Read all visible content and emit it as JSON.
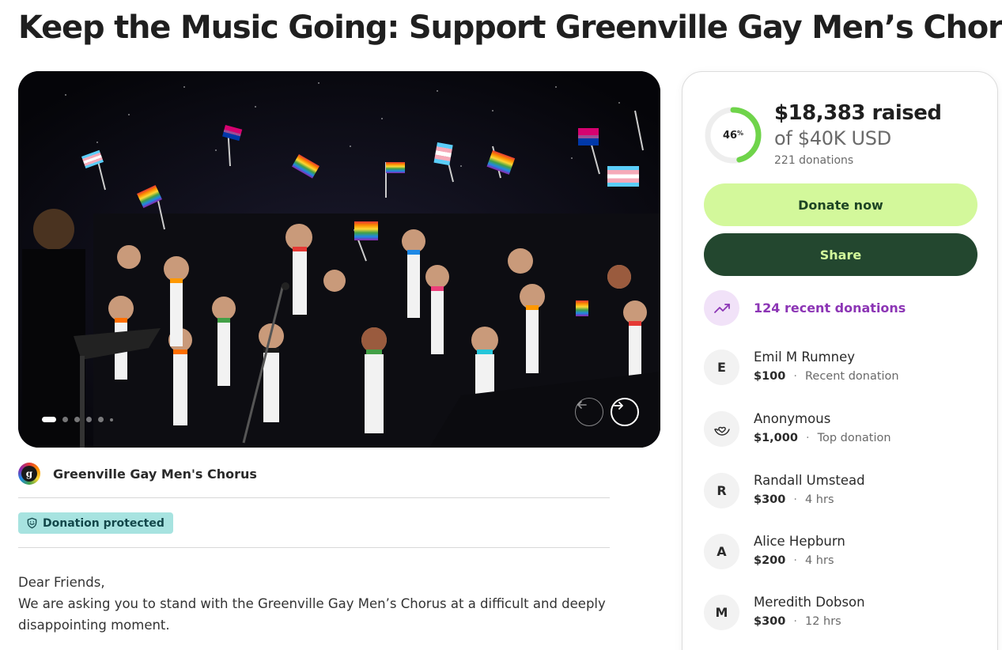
{
  "page": {
    "title": "Keep the Music Going: Support Greenville Gay Men’s Chorus"
  },
  "gallery": {
    "image_icon": "chorus-performance-photo",
    "slide_count": 6,
    "active_slide": 1,
    "prev_icon": "arrow-left-icon",
    "next_icon": "arrow-right-icon"
  },
  "organizer": {
    "logo_letter": "g",
    "name": "Greenville Gay Men's Chorus"
  },
  "badge": {
    "icon": "shield-icon",
    "label": "Donation protected"
  },
  "story": {
    "line1": "Dear Friends,",
    "line2": "We are asking you to stand with the Greenville Gay Men’s Chorus at a difficult and deeply disappointing moment."
  },
  "campaign": {
    "progress_fraction": 0.46,
    "progress_number": "46",
    "progress_symbol": "%",
    "raised": "$18,383 raised",
    "goal": "of $40K USD",
    "donations": "221 donations",
    "colors": {
      "progress": "#6fd44a",
      "track": "#eeeeee"
    }
  },
  "actions": {
    "donate_label": "Donate now",
    "share_label": "Share"
  },
  "recent": {
    "icon": "trending-up-icon",
    "label": "124 recent donations"
  },
  "donors": [
    {
      "initial": "E",
      "name": "Emil M Rumney",
      "amount": "$100",
      "note": "Recent donation"
    },
    {
      "initial": "",
      "icon": "heart-hand-icon",
      "name": "Anonymous",
      "amount": "$1,000",
      "note": "Top donation"
    },
    {
      "initial": "R",
      "name": "Randall Umstead",
      "amount": "$300",
      "note": "4 hrs"
    },
    {
      "initial": "A",
      "name": "Alice Hepburn",
      "amount": "$200",
      "note": "4 hrs"
    },
    {
      "initial": "M",
      "name": "Meredith Dobson",
      "amount": "$300",
      "note": "12 hrs"
    }
  ]
}
